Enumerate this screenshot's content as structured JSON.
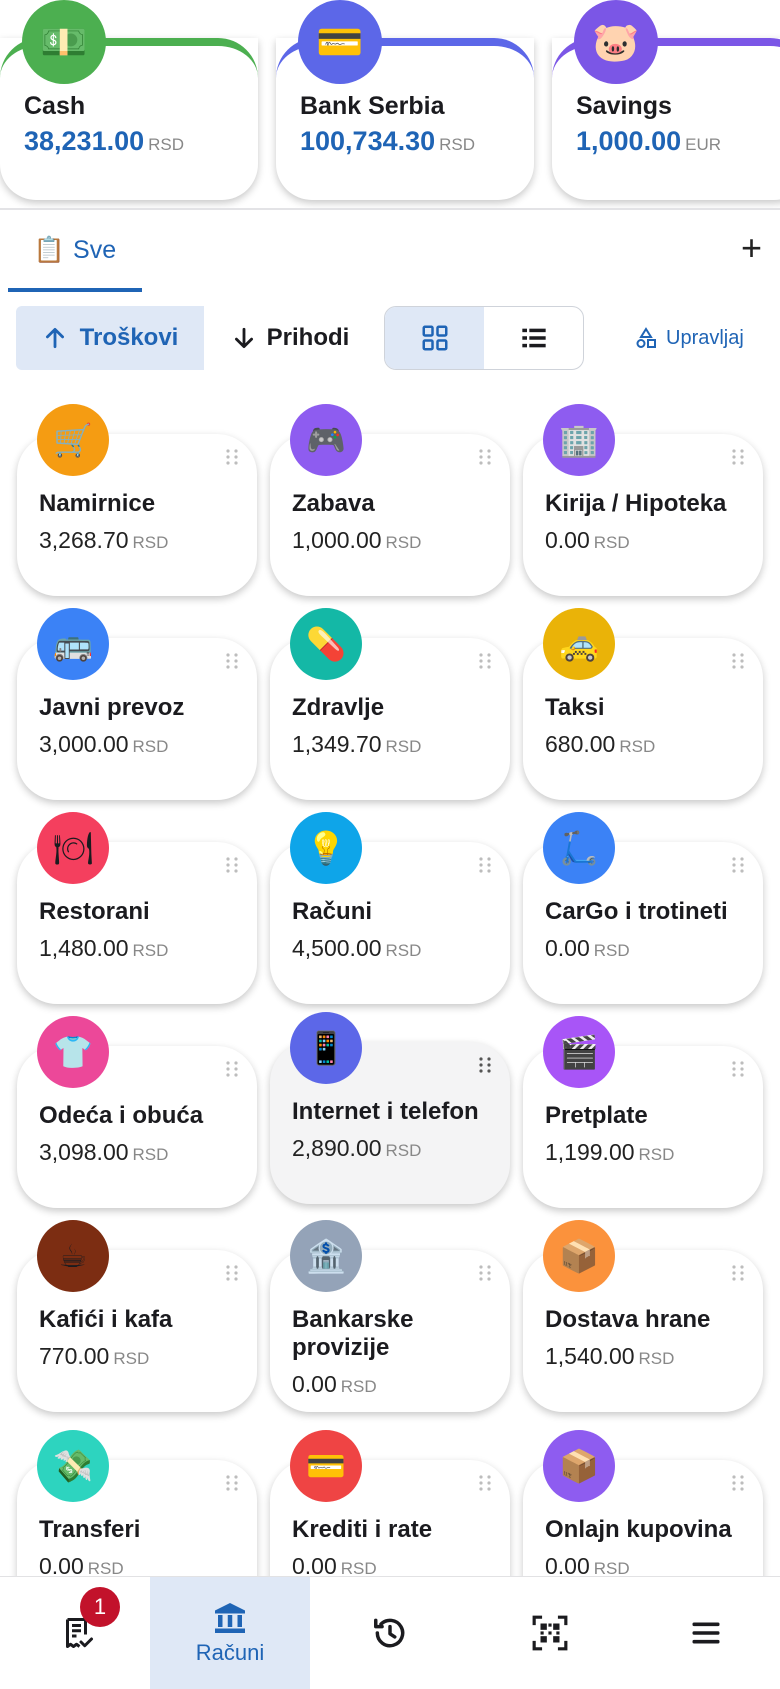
{
  "accounts": [
    {
      "name": "Cash",
      "amount": "38,231.00",
      "currency": "RSD",
      "icon": "money-icon",
      "glyph": "💵",
      "color": "#4caf50"
    },
    {
      "name": "Bank Serbia",
      "amount": "100,734.30",
      "currency": "RSD",
      "icon": "card-icon",
      "glyph": "💳",
      "color": "#5c67e8"
    },
    {
      "name": "Savings",
      "amount": "1,000.00",
      "currency": "EUR",
      "icon": "piggy-bank-icon",
      "glyph": "🐷",
      "color": "#7b56e6"
    }
  ],
  "tabs": {
    "all_label": "Sve",
    "all_glyph": "📋",
    "add_glyph": "+"
  },
  "controls": {
    "expenses_label": "Troškovi",
    "income_label": "Prihodi",
    "manage_label": "Upravljaj"
  },
  "categories": [
    {
      "name": "Namirnice",
      "value": "3,268.70",
      "currency": "RSD",
      "icon": "shopping-cart-icon",
      "glyph": "🛒",
      "color": "#f59c12"
    },
    {
      "name": "Zabava",
      "value": "1,000.00",
      "currency": "RSD",
      "icon": "game-controller-icon",
      "glyph": "🎮",
      "color": "#8e5cf0"
    },
    {
      "name": "Kirija / Hipoteka",
      "value": "0.00",
      "currency": "RSD",
      "icon": "building-icon",
      "glyph": "🏢",
      "color": "#8e5cf0"
    },
    {
      "name": "Javni prevoz",
      "value": "3,000.00",
      "currency": "RSD",
      "icon": "bus-icon",
      "glyph": "🚌",
      "color": "#3b82f6"
    },
    {
      "name": "Zdravlje",
      "value": "1,349.70",
      "currency": "RSD",
      "icon": "pill-icon",
      "glyph": "💊",
      "color": "#14b8a6"
    },
    {
      "name": "Taksi",
      "value": "680.00",
      "currency": "RSD",
      "icon": "taxi-icon",
      "glyph": "🚕",
      "color": "#eab308"
    },
    {
      "name": "Restorani",
      "value": "1,480.00",
      "currency": "RSD",
      "icon": "plate-icon",
      "glyph": "🍽",
      "color": "#f43f5e"
    },
    {
      "name": "Računi",
      "value": "4,500.00",
      "currency": "RSD",
      "icon": "light-bulb-icon",
      "glyph": "💡",
      "color": "#0ea5e9"
    },
    {
      "name": "CarGo i trotineti",
      "value": "0.00",
      "currency": "RSD",
      "icon": "scooter-icon",
      "glyph": "🛴",
      "color": "#3b82f6"
    },
    {
      "name": "Odeća i obuća",
      "value": "3,098.00",
      "currency": "RSD",
      "icon": "tshirt-icon",
      "glyph": "👕",
      "color": "#ec4899"
    },
    {
      "name": "Internet i telefon",
      "value": "2,890.00",
      "currency": "RSD",
      "icon": "mobile-phone-icon",
      "glyph": "📱",
      "color": "#5c67e8"
    },
    {
      "name": "Pretplate",
      "value": "1,199.00",
      "currency": "RSD",
      "icon": "clapper-board-icon",
      "glyph": "🎬",
      "color": "#a855f7"
    },
    {
      "name": "Kafići i kafa",
      "value": "770.00",
      "currency": "RSD",
      "icon": "coffee-icon",
      "glyph": "☕",
      "color": "#7c2d12"
    },
    {
      "name": "Bankarske provizije",
      "value": "0.00",
      "currency": "RSD",
      "icon": "bank-icon",
      "glyph": "🏦",
      "color": "#94a3b8"
    },
    {
      "name": "Dostava hrane",
      "value": "1,540.00",
      "currency": "RSD",
      "icon": "package-icon",
      "glyph": "📦",
      "color": "#fb923c"
    },
    {
      "name": "Transferi",
      "value": "0.00",
      "currency": "RSD",
      "icon": "money-wings-icon",
      "glyph": "💸",
      "color": "#2dd4bf"
    },
    {
      "name": "Krediti i rate",
      "value": "0.00",
      "currency": "RSD",
      "icon": "credit-card-icon",
      "glyph": "💳",
      "color": "#ef4444"
    },
    {
      "name": "Onlajn kupovina",
      "value": "0.00",
      "currency": "RSD",
      "icon": "package-icon",
      "glyph": "📦",
      "color": "#8e5cf0"
    }
  ],
  "nav": {
    "receipts_badge": "1",
    "accounts_label": "Računi"
  }
}
